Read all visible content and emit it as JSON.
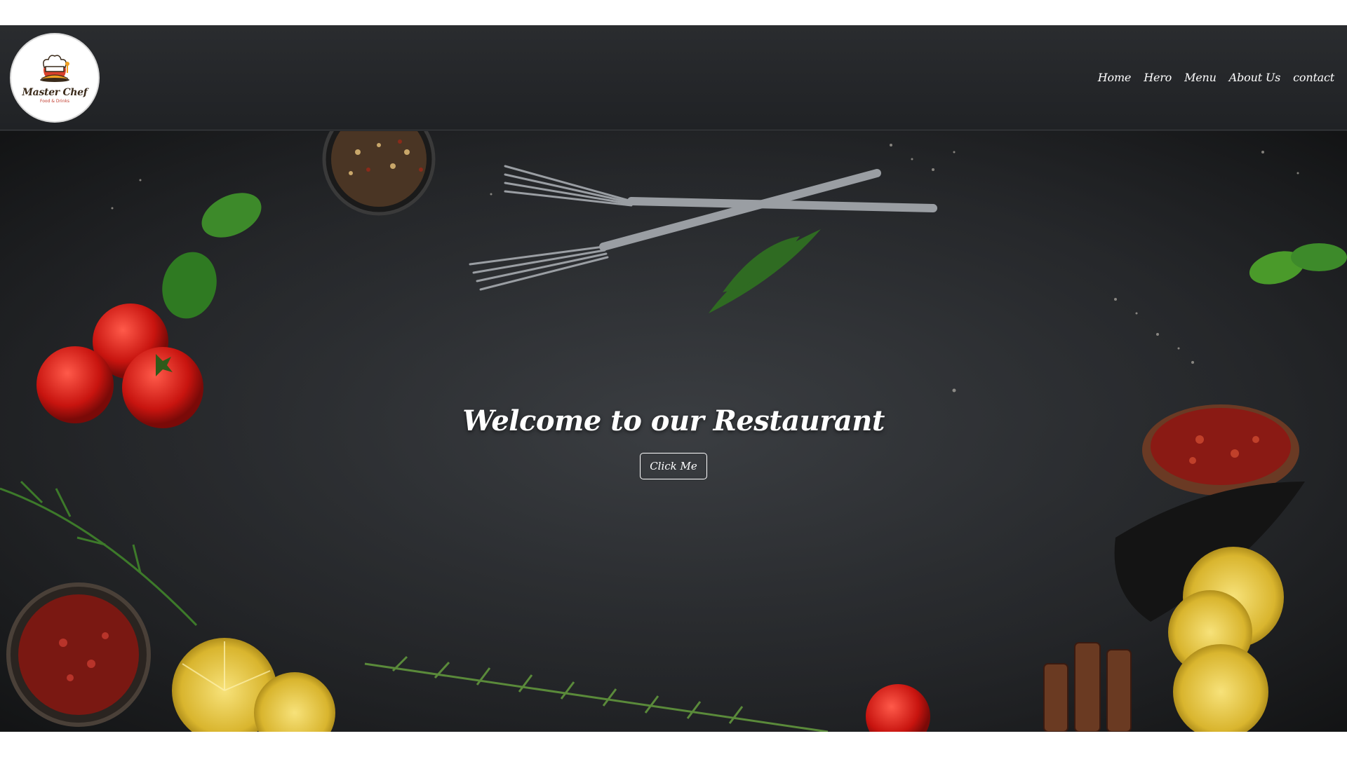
{
  "brand": {
    "name": "Master Chef",
    "tagline": "Food & Drinks",
    "logo_icon": "chef-hat-icon"
  },
  "nav": {
    "items": [
      {
        "label": "Home"
      },
      {
        "label": "Hero"
      },
      {
        "label": "Menu"
      },
      {
        "label": "About Us"
      },
      {
        "label": "contact"
      }
    ]
  },
  "hero": {
    "title": "Welcome to our Restaurant",
    "button_label": "Click Me"
  },
  "colors": {
    "header_bg": "#26282b",
    "hero_bg": "#222426",
    "text": "#ffffff"
  }
}
